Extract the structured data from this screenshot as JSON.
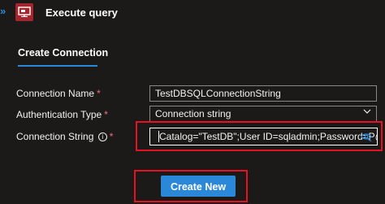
{
  "header": {
    "expand_glyph": "»",
    "app_icon": "query-monitor-icon",
    "title": "Execute query"
  },
  "tabs": [
    {
      "label": "Create Connection",
      "active": true
    }
  ],
  "form": {
    "connection_name": {
      "label": "Connection Name",
      "required_mark": "*",
      "value": "TestDBSQLConnectionString"
    },
    "authentication_type": {
      "label": "Authentication Type",
      "required_mark": "*",
      "value": "Connection string",
      "icon": "chevron-down-icon"
    },
    "connection_string": {
      "label": "Connection String",
      "info_glyph": "i",
      "required_mark": "*",
      "value": "Catalog=\"TestDB\";User ID=sqladmin;Password=P@ss",
      "icon": "eye-icon"
    }
  },
  "actions": {
    "create_new_label": "Create New"
  },
  "colors": {
    "background": "#1b1a19",
    "accent": "#2b88d8",
    "highlight": "#e81123",
    "required": "#f1707b",
    "app_icon_bg": "#a4262c"
  }
}
